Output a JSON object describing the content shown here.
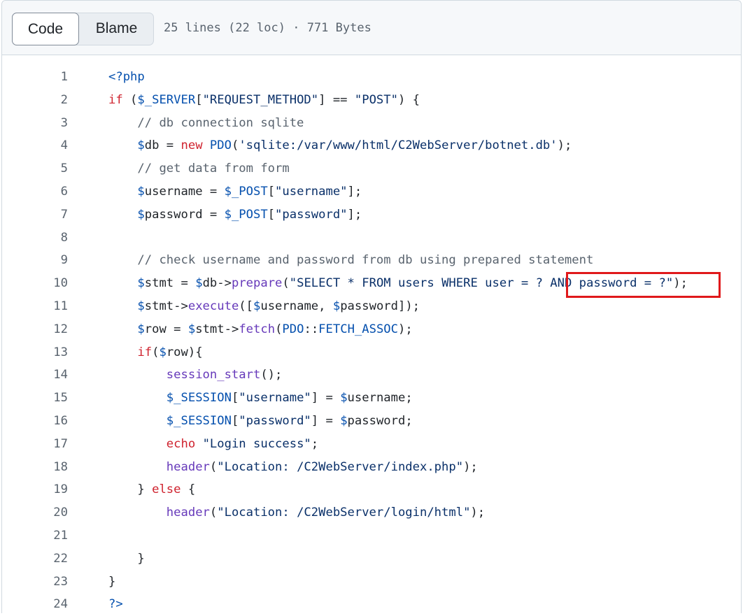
{
  "toolbar": {
    "code_label": "Code",
    "blame_label": "Blame",
    "file_info": "25 lines (22 loc) · 771 Bytes"
  },
  "code_lines": [
    {
      "n": "1",
      "tokens": [
        {
          "t": "v",
          "s": "<?php"
        }
      ]
    },
    {
      "n": "2",
      "tokens": [
        {
          "t": "k",
          "s": "if"
        },
        {
          "t": "",
          "s": " ("
        },
        {
          "t": "v",
          "s": "$_SERVER"
        },
        {
          "t": "",
          "s": "["
        },
        {
          "t": "s",
          "s": "\"REQUEST_METHOD\""
        },
        {
          "t": "",
          "s": "] == "
        },
        {
          "t": "s",
          "s": "\"POST\""
        },
        {
          "t": "",
          "s": ") {"
        }
      ]
    },
    {
      "n": "3",
      "tokens": [
        {
          "t": "",
          "s": "    "
        },
        {
          "t": "c",
          "s": "// db connection sqlite"
        }
      ]
    },
    {
      "n": "4",
      "tokens": [
        {
          "t": "",
          "s": "    "
        },
        {
          "t": "v",
          "s": "$"
        },
        {
          "t": "",
          "s": "db = "
        },
        {
          "t": "k",
          "s": "new"
        },
        {
          "t": "",
          "s": " "
        },
        {
          "t": "v",
          "s": "PDO"
        },
        {
          "t": "",
          "s": "("
        },
        {
          "t": "s",
          "s": "'sqlite:/var/www/html/C2WebServer/botnet.db'"
        },
        {
          "t": "",
          "s": ");"
        }
      ]
    },
    {
      "n": "5",
      "tokens": [
        {
          "t": "",
          "s": "    "
        },
        {
          "t": "c",
          "s": "// get data from form"
        }
      ]
    },
    {
      "n": "6",
      "tokens": [
        {
          "t": "",
          "s": "    "
        },
        {
          "t": "v",
          "s": "$"
        },
        {
          "t": "",
          "s": "username = "
        },
        {
          "t": "v",
          "s": "$_POST"
        },
        {
          "t": "",
          "s": "["
        },
        {
          "t": "s",
          "s": "\"username\""
        },
        {
          "t": "",
          "s": "];"
        }
      ]
    },
    {
      "n": "7",
      "tokens": [
        {
          "t": "",
          "s": "    "
        },
        {
          "t": "v",
          "s": "$"
        },
        {
          "t": "",
          "s": "password = "
        },
        {
          "t": "v",
          "s": "$_POST"
        },
        {
          "t": "",
          "s": "["
        },
        {
          "t": "s",
          "s": "\"password\""
        },
        {
          "t": "",
          "s": "];"
        }
      ]
    },
    {
      "n": "8",
      "tokens": []
    },
    {
      "n": "9",
      "tokens": [
        {
          "t": "",
          "s": "    "
        },
        {
          "t": "c",
          "s": "// check username and password from db using prepared statement"
        }
      ]
    },
    {
      "n": "10",
      "tokens": [
        {
          "t": "",
          "s": "    "
        },
        {
          "t": "v",
          "s": "$"
        },
        {
          "t": "",
          "s": "stmt = "
        },
        {
          "t": "v",
          "s": "$"
        },
        {
          "t": "",
          "s": "db->"
        },
        {
          "t": "f",
          "s": "prepare"
        },
        {
          "t": "",
          "s": "("
        },
        {
          "t": "s",
          "s": "\"SELECT * FROM users WHERE user = ? AND password = ?\""
        },
        {
          "t": "",
          "s": ");"
        }
      ]
    },
    {
      "n": "11",
      "tokens": [
        {
          "t": "",
          "s": "    "
        },
        {
          "t": "v",
          "s": "$"
        },
        {
          "t": "",
          "s": "stmt->"
        },
        {
          "t": "f",
          "s": "execute"
        },
        {
          "t": "",
          "s": "(["
        },
        {
          "t": "v",
          "s": "$"
        },
        {
          "t": "",
          "s": "username, "
        },
        {
          "t": "v",
          "s": "$"
        },
        {
          "t": "",
          "s": "password]);"
        }
      ]
    },
    {
      "n": "12",
      "tokens": [
        {
          "t": "",
          "s": "    "
        },
        {
          "t": "v",
          "s": "$"
        },
        {
          "t": "",
          "s": "row = "
        },
        {
          "t": "v",
          "s": "$"
        },
        {
          "t": "",
          "s": "stmt->"
        },
        {
          "t": "f",
          "s": "fetch"
        },
        {
          "t": "",
          "s": "("
        },
        {
          "t": "v",
          "s": "PDO"
        },
        {
          "t": "",
          "s": "::"
        },
        {
          "t": "v",
          "s": "FETCH_ASSOC"
        },
        {
          "t": "",
          "s": ");"
        }
      ]
    },
    {
      "n": "13",
      "tokens": [
        {
          "t": "",
          "s": "    "
        },
        {
          "t": "k",
          "s": "if"
        },
        {
          "t": "",
          "s": "("
        },
        {
          "t": "v",
          "s": "$"
        },
        {
          "t": "",
          "s": "row){"
        }
      ]
    },
    {
      "n": "14",
      "tokens": [
        {
          "t": "",
          "s": "        "
        },
        {
          "t": "f",
          "s": "session_start"
        },
        {
          "t": "",
          "s": "();"
        }
      ]
    },
    {
      "n": "15",
      "tokens": [
        {
          "t": "",
          "s": "        "
        },
        {
          "t": "v",
          "s": "$_SESSION"
        },
        {
          "t": "",
          "s": "["
        },
        {
          "t": "s",
          "s": "\"username\""
        },
        {
          "t": "",
          "s": "] = "
        },
        {
          "t": "v",
          "s": "$"
        },
        {
          "t": "",
          "s": "username;"
        }
      ]
    },
    {
      "n": "16",
      "tokens": [
        {
          "t": "",
          "s": "        "
        },
        {
          "t": "v",
          "s": "$_SESSION"
        },
        {
          "t": "",
          "s": "["
        },
        {
          "t": "s",
          "s": "\"password\""
        },
        {
          "t": "",
          "s": "] = "
        },
        {
          "t": "v",
          "s": "$"
        },
        {
          "t": "",
          "s": "password;"
        }
      ]
    },
    {
      "n": "17",
      "tokens": [
        {
          "t": "",
          "s": "        "
        },
        {
          "t": "k",
          "s": "echo"
        },
        {
          "t": "",
          "s": " "
        },
        {
          "t": "s",
          "s": "\"Login success\""
        },
        {
          "t": "",
          "s": ";"
        }
      ]
    },
    {
      "n": "18",
      "tokens": [
        {
          "t": "",
          "s": "        "
        },
        {
          "t": "f",
          "s": "header"
        },
        {
          "t": "",
          "s": "("
        },
        {
          "t": "s",
          "s": "\"Location: /C2WebServer/index.php\""
        },
        {
          "t": "",
          "s": ");"
        }
      ]
    },
    {
      "n": "19",
      "tokens": [
        {
          "t": "",
          "s": "    } "
        },
        {
          "t": "k",
          "s": "else"
        },
        {
          "t": "",
          "s": " {"
        }
      ]
    },
    {
      "n": "20",
      "tokens": [
        {
          "t": "",
          "s": "        "
        },
        {
          "t": "f",
          "s": "header"
        },
        {
          "t": "",
          "s": "("
        },
        {
          "t": "s",
          "s": "\"Location: /C2WebServer/login/html\""
        },
        {
          "t": "",
          "s": ");"
        }
      ]
    },
    {
      "n": "21",
      "tokens": []
    },
    {
      "n": "22",
      "tokens": [
        {
          "t": "",
          "s": "    }"
        }
      ]
    },
    {
      "n": "23",
      "tokens": [
        {
          "t": "",
          "s": "}"
        }
      ]
    },
    {
      "n": "24",
      "tokens": [
        {
          "t": "v",
          "s": "?>"
        }
      ]
    }
  ],
  "annotation": {
    "color": "#e0191b",
    "target_text": "AND password = ?\""
  }
}
